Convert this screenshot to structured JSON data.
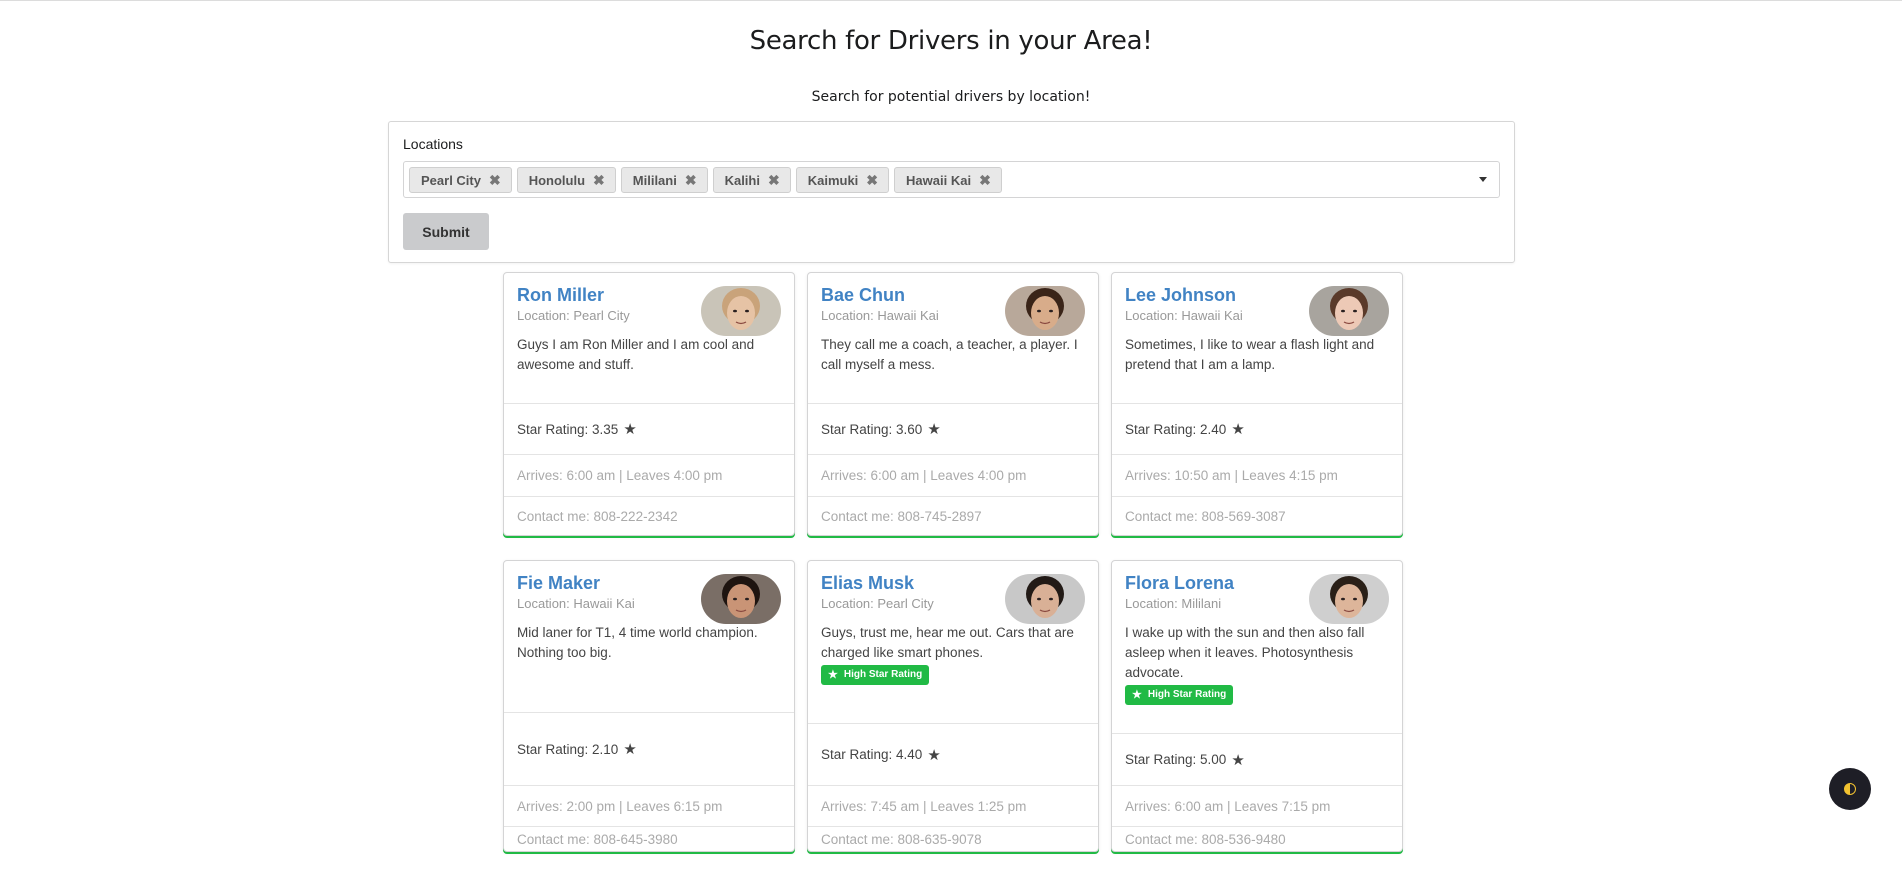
{
  "header": {
    "title": "Search for Drivers in your Area!",
    "subtitle": "Search for potential drivers by location!"
  },
  "search": {
    "label": "Locations",
    "chips": [
      "Pearl City",
      "Honolulu",
      "Mililani",
      "Kalihi",
      "Kaimuki",
      "Hawaii Kai"
    ],
    "remove_glyph": "✖",
    "submit_label": "Submit"
  },
  "cards": [
    {
      "name": "Ron Miller",
      "location": "Location: Pearl City",
      "description": "Guys I am Ron Miller and I am cool and awesome and stuff.",
      "badge": "",
      "rating": "Star Rating: 3.35",
      "times": "Arrives: 6:00 am | Leaves 4:00 pm",
      "contact": "Contact me: 808-222-2342",
      "avatar": {
        "skin": "#e6c3a5",
        "hair": "#c9a37a",
        "bg": "#c9c4b8"
      }
    },
    {
      "name": "Bae Chun",
      "location": "Location: Hawaii Kai",
      "description": "They call me a coach, a teacher, a player. I call myself a mess.",
      "badge": "",
      "rating": "Star Rating: 3.60",
      "times": "Arrives: 6:00 am | Leaves 4:00 pm",
      "contact": "Contact me: 808-745-2897",
      "avatar": {
        "skin": "#d8ac8a",
        "hair": "#3a2418",
        "bg": "#b8a89a"
      }
    },
    {
      "name": "Lee Johnson",
      "location": "Location: Hawaii Kai",
      "description": "Sometimes, I like to wear a flash light and pretend that I am a lamp.",
      "badge": "",
      "rating": "Star Rating: 2.40",
      "times": "Arrives: 10:50 am | Leaves 4:15 pm",
      "contact": "Contact me: 808-569-3087",
      "avatar": {
        "skin": "#edc9b6",
        "hair": "#5a3a2a",
        "bg": "#a8a49e"
      }
    },
    {
      "name": "Fie Maker",
      "location": "Location: Hawaii Kai",
      "description": "Mid laner for T1, 4 time world champion. Nothing too big.",
      "badge": "",
      "rating": "Star Rating: 2.10",
      "times": "Arrives: 2:00 pm | Leaves 6:15 pm",
      "contact": "Contact me: 808-645-3980",
      "avatar": {
        "skin": "#c99476",
        "hair": "#1e1410",
        "bg": "#7a6e66"
      }
    },
    {
      "name": "Elias Musk",
      "location": "Location: Pearl City",
      "description": "Guys, trust me, hear me out. Cars that are charged like smart phones.",
      "badge": "High Star Rating",
      "rating": "Star Rating: 4.40",
      "times": "Arrives: 7:45 am | Leaves 1:25 pm",
      "contact": "Contact me: 808-635-9078",
      "avatar": {
        "skin": "#d9b096",
        "hair": "#221a16",
        "bg": "#c8c8c8"
      }
    },
    {
      "name": "Flora Lorena",
      "location": "Location: Mililani",
      "description": "I wake up with the sun and then also fall asleep when it leaves. Photosynthesis advocate.",
      "badge": "High Star Rating",
      "rating": "Star Rating: 5.00",
      "times": "Arrives: 6:00 am | Leaves 7:15 pm",
      "contact": "Contact me: 808-536-9480",
      "avatar": {
        "skin": "#ddb59a",
        "hair": "#2a2018",
        "bg": "#cfcfcf"
      }
    }
  ],
  "icons": {
    "star": "★",
    "badge_star": "★"
  },
  "colors": {
    "accent_link": "#4183c4",
    "badge_green": "#21ba45",
    "button_grey": "#cacbcd"
  }
}
